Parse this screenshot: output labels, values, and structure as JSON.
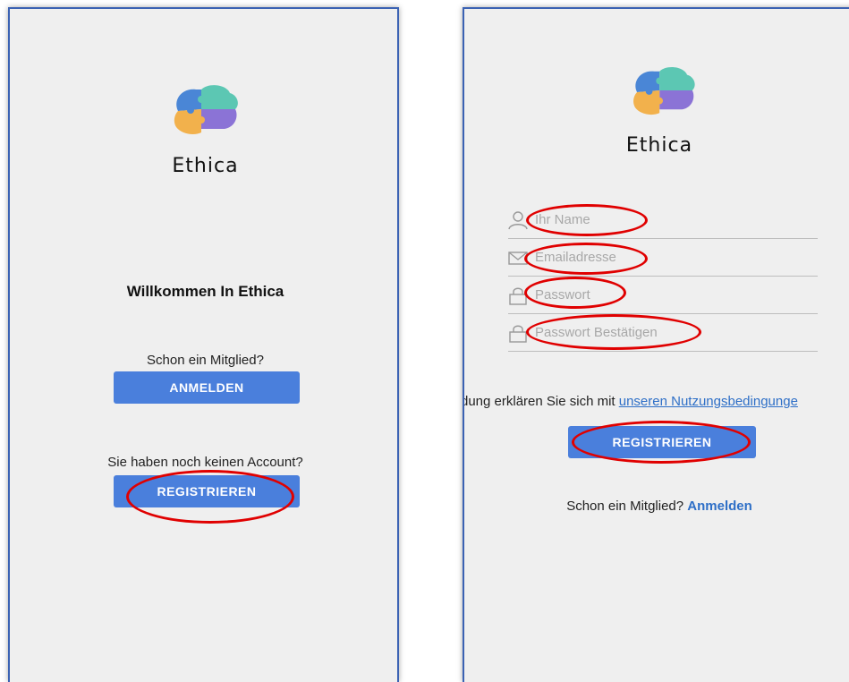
{
  "left_screen": {
    "brand": "Ethica",
    "welcome_heading": "Willkommen In Ethica",
    "member_question": "Schon ein Mitglied?",
    "login_button": "ANMELDEN",
    "no_account_question": "Sie haben noch keinen Account?",
    "register_button": "REGISTRIEREN"
  },
  "right_screen": {
    "brand": "Ethica",
    "fields": {
      "name_placeholder": "Ihr Name",
      "email_placeholder": "Emailadresse",
      "password_placeholder": "Passwort",
      "confirm_password_placeholder": "Passwort Bestätigen"
    },
    "terms_prefix": "dung erklären Sie sich mit ",
    "terms_link": "unseren Nutzungsbedingunge",
    "register_button": "REGISTRIEREN",
    "member_question": "Schon ein Mitglied?",
    "login_link": "Anmelden"
  },
  "colors": {
    "button_blue": "#4a7fdc",
    "link_blue": "#2e6fc7",
    "annotation_red": "#e00000",
    "screen_background": "#efefef"
  },
  "icons": [
    "brain-puzzle-logo-icon",
    "user-icon",
    "mail-icon",
    "lock-icon"
  ]
}
